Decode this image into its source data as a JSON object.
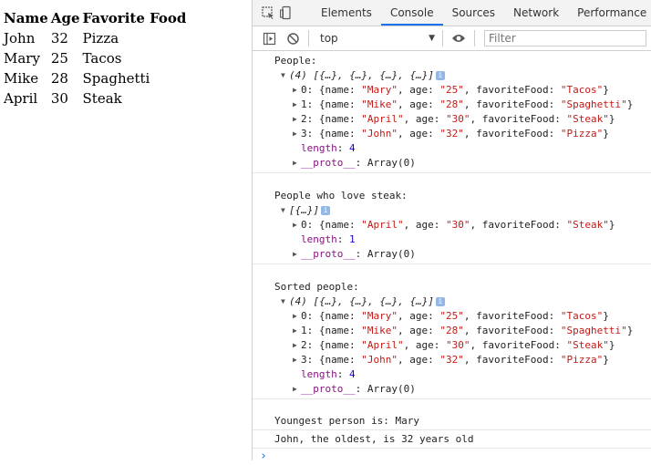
{
  "page": {
    "headers": [
      "Name",
      "Age",
      "Favorite Food"
    ],
    "rows": [
      [
        "John",
        "32",
        "Pizza"
      ],
      [
        "Mary",
        "25",
        "Tacos"
      ],
      [
        "Mike",
        "28",
        "Spaghetti"
      ],
      [
        "April",
        "30",
        "Steak"
      ]
    ]
  },
  "devtools": {
    "tabs": [
      "Elements",
      "Console",
      "Sources",
      "Network",
      "Performance"
    ],
    "active_tab": "Console",
    "context": "top",
    "filter_placeholder": "Filter"
  },
  "console": {
    "group1": {
      "label": "People:",
      "summary": "(4) [{…}, {…}, {…}, {…}]",
      "items": [
        {
          "idx": "0",
          "name": "\"Mary\"",
          "age": "\"25\"",
          "food": "\"Tacos\""
        },
        {
          "idx": "1",
          "name": "\"Mike\"",
          "age": "\"28\"",
          "food": "\"Spaghetti\""
        },
        {
          "idx": "2",
          "name": "\"April\"",
          "age": "\"30\"",
          "food": "\"Steak\""
        },
        {
          "idx": "3",
          "name": "\"John\"",
          "age": "\"32\"",
          "food": "\"Pizza\""
        }
      ],
      "length_key": "length",
      "length_val": "4",
      "proto_key": "__proto__",
      "proto_val": "Array(0)"
    },
    "group2": {
      "label": "People who love steak:",
      "summary": "[{…}]",
      "items": [
        {
          "idx": "0",
          "name": "\"April\"",
          "age": "\"30\"",
          "food": "\"Steak\""
        }
      ],
      "length_key": "length",
      "length_val": "1",
      "proto_key": "__proto__",
      "proto_val": "Array(0)"
    },
    "group3": {
      "label": "Sorted people:",
      "summary": "(4) [{…}, {…}, {…}, {…}]",
      "items": [
        {
          "idx": "0",
          "name": "\"Mary\"",
          "age": "\"25\"",
          "food": "\"Tacos\""
        },
        {
          "idx": "1",
          "name": "\"Mike\"",
          "age": "\"28\"",
          "food": "\"Spaghetti\""
        },
        {
          "idx": "2",
          "name": "\"April\"",
          "age": "\"30\"",
          "food": "\"Steak\""
        },
        {
          "idx": "3",
          "name": "\"John\"",
          "age": "\"32\"",
          "food": "\"Pizza\""
        }
      ],
      "length_key": "length",
      "length_val": "4",
      "proto_key": "__proto__",
      "proto_val": "Array(0)"
    },
    "msg_youngest": "Youngest person is: Mary",
    "msg_oldest": "John, the oldest, is 32 years old",
    "syntax": {
      "name_key": "name",
      "age_key": "age",
      "food_key": "favoriteFood"
    }
  },
  "colors": {
    "accent": "#1a73e8",
    "string": "#c41a16",
    "number": "#1c00cf",
    "key": "#881280"
  }
}
